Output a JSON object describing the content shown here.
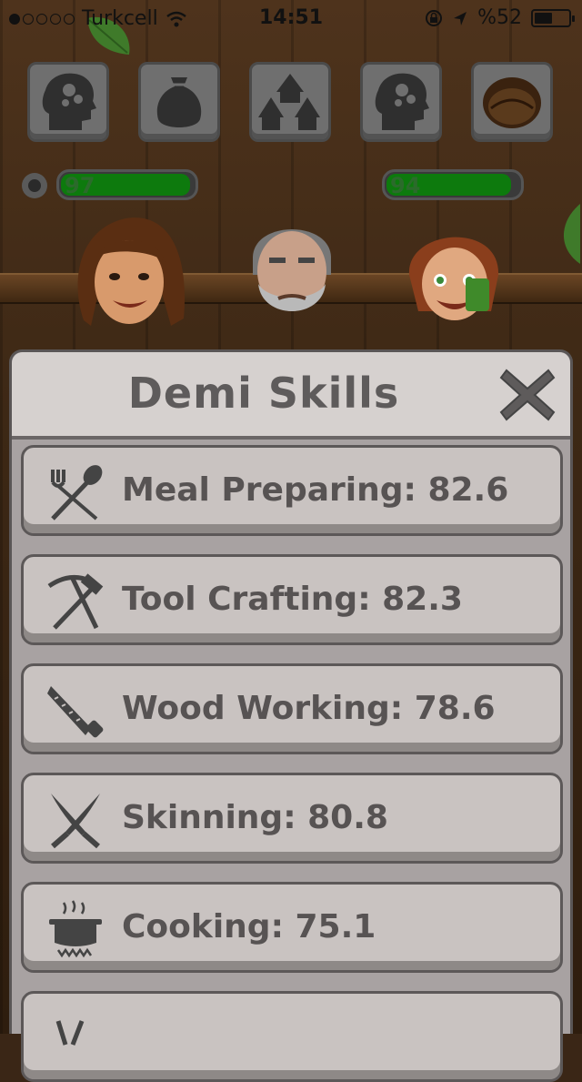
{
  "status_bar": {
    "carrier": "Turkcell",
    "time": "14:51",
    "battery_text": "%52",
    "battery_level": 0.52
  },
  "top_buttons": [
    {
      "name": "skills-head-icon"
    },
    {
      "name": "bag-icon"
    },
    {
      "name": "huts-icon"
    },
    {
      "name": "skills-head-icon"
    },
    {
      "name": "coconut-icon"
    }
  ],
  "bars": [
    {
      "value": "97",
      "level": 0.97
    },
    {
      "value": "94",
      "level": 0.94
    }
  ],
  "dialog": {
    "title": "Demi Skills",
    "skills": [
      {
        "label": "Meal Preparing: 82.6",
        "icon": "fork-spoon-icon"
      },
      {
        "label": "Tool Crafting: 82.3",
        "icon": "pickaxe-hammer-icon"
      },
      {
        "label": "Wood Working: 78.6",
        "icon": "saw-icon"
      },
      {
        "label": "Skinning: 80.8",
        "icon": "knives-icon"
      },
      {
        "label": "Cooking: 75.1",
        "icon": "cooking-pot-icon"
      }
    ]
  }
}
